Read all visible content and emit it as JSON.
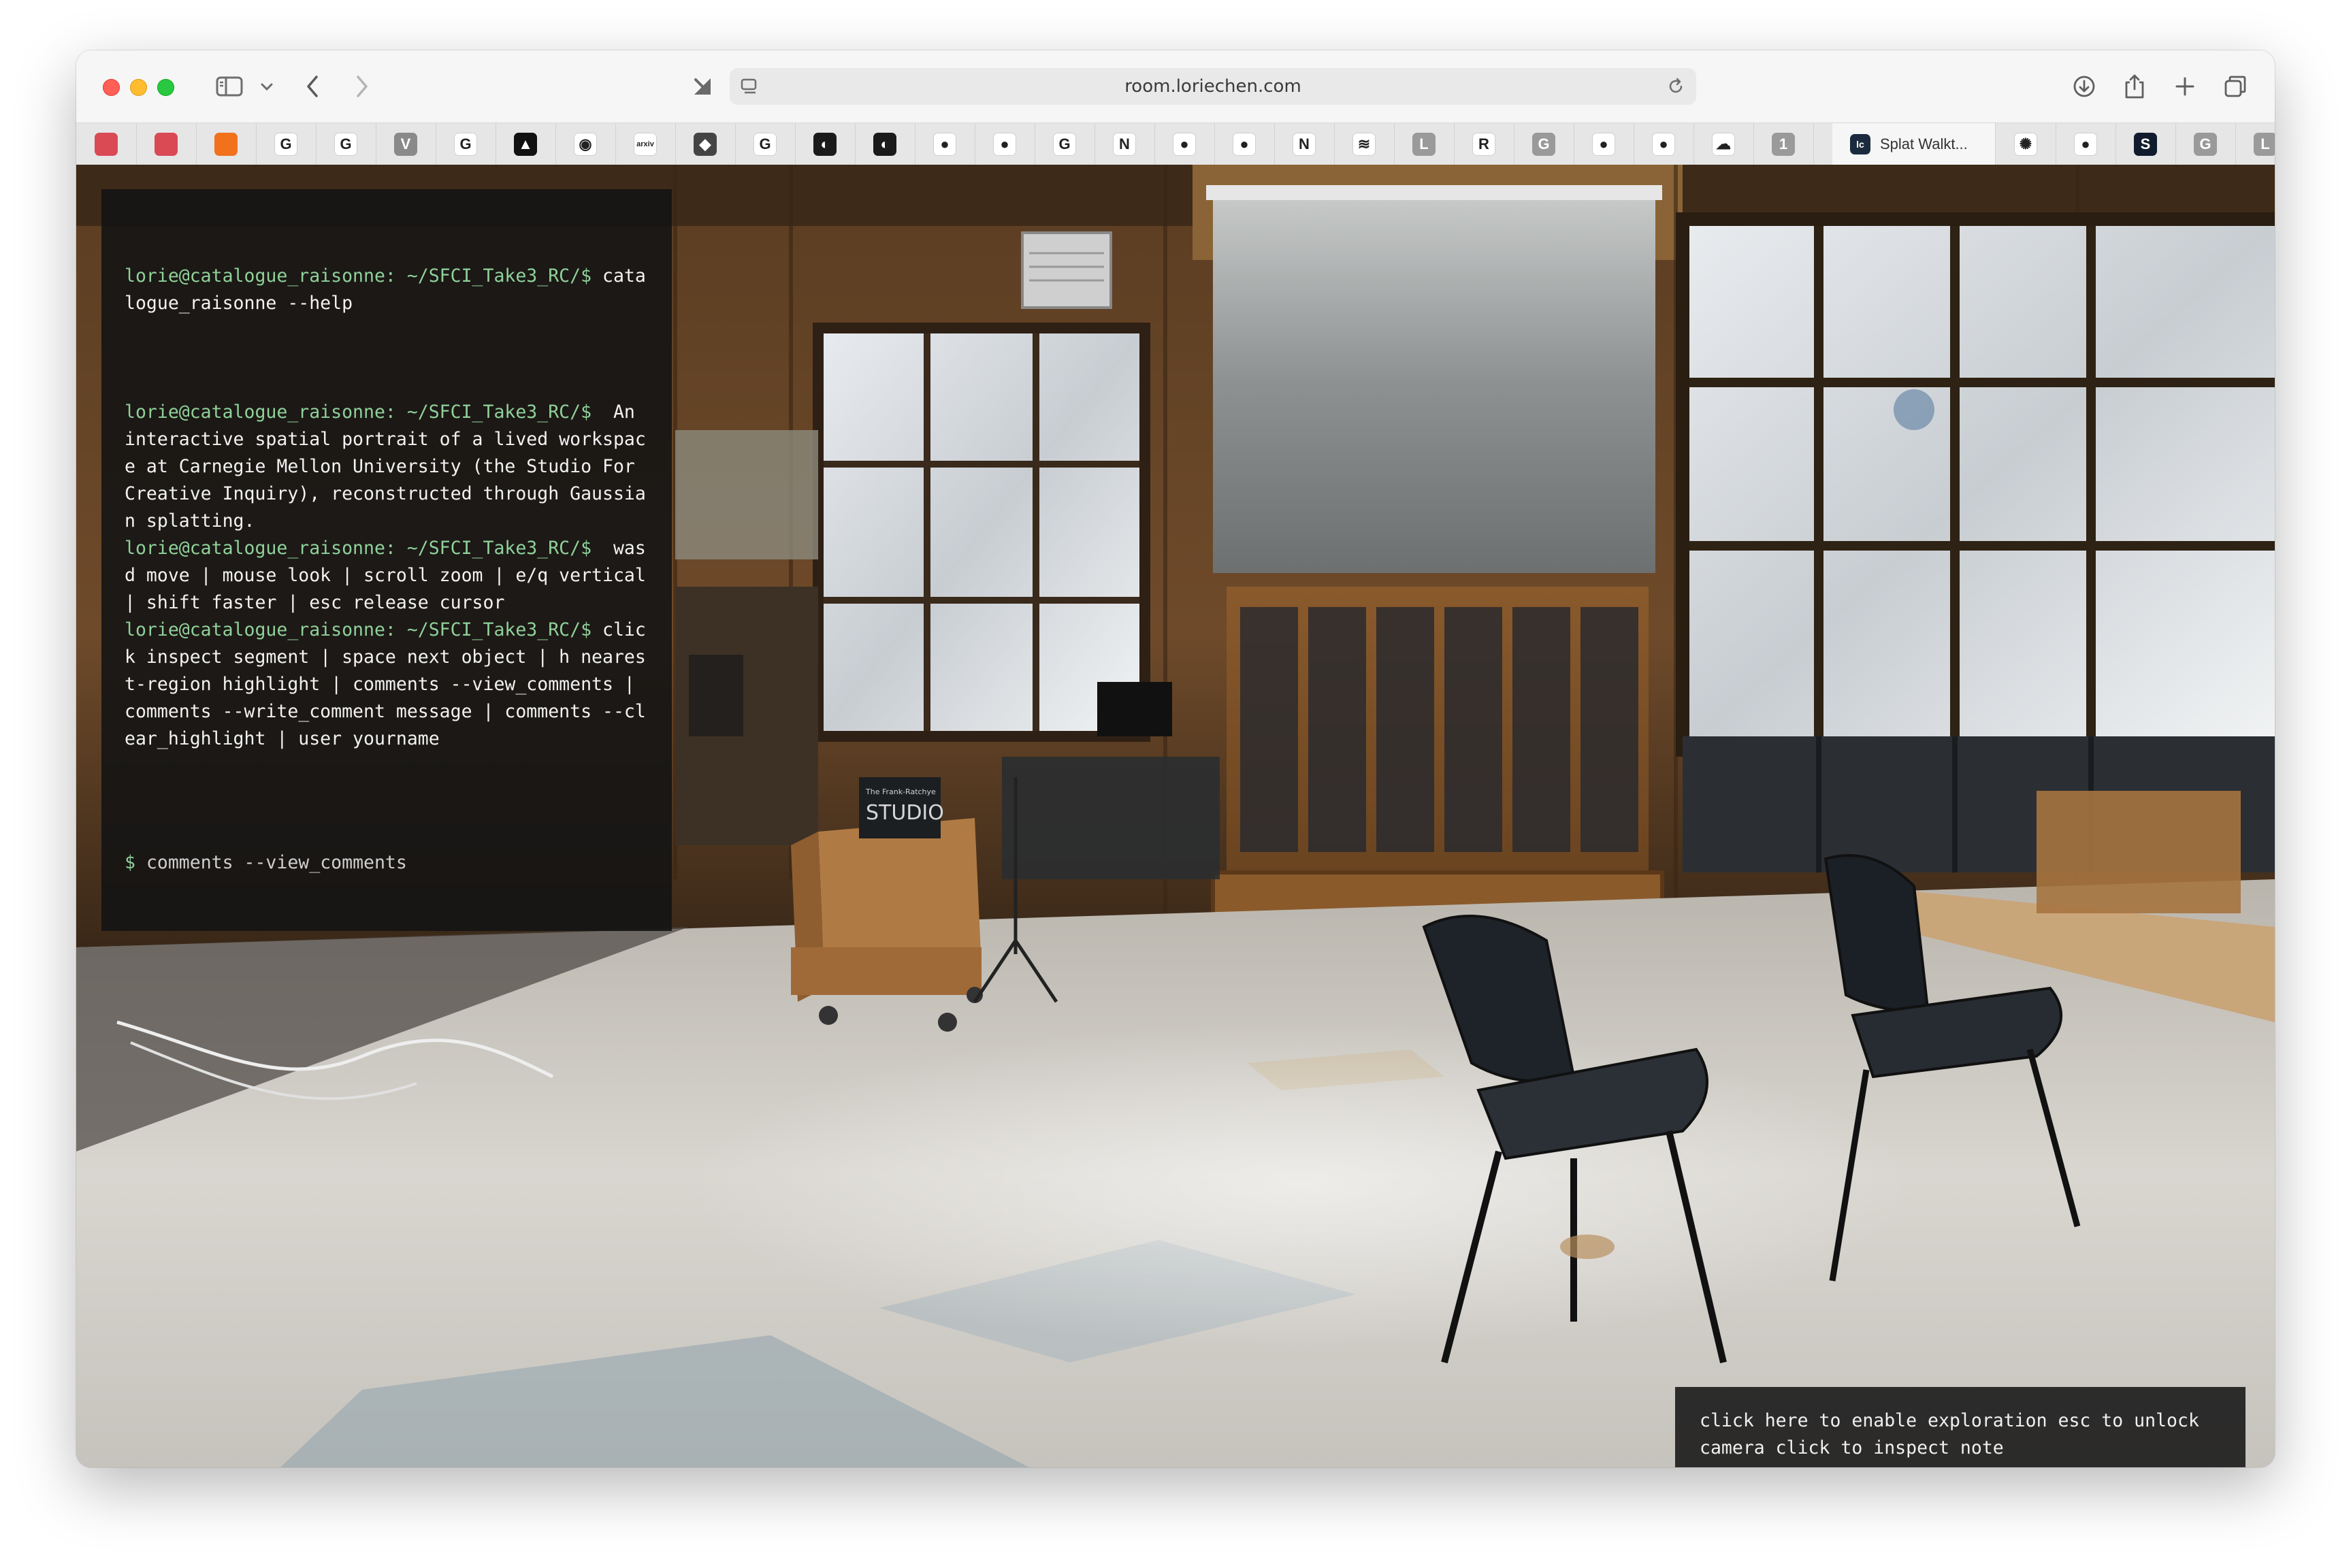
{
  "browser": {
    "url": "room.loriechen.com",
    "active_tab_title": "Splat Walkt...",
    "active_tab_icon_text": "lc",
    "favorites": [
      {
        "icon": "bookmark-red-icon",
        "glyph": "",
        "color": "#d94a55"
      },
      {
        "icon": "bookmark-red-icon",
        "glyph": "",
        "color": "#d94a55"
      },
      {
        "icon": "stack-orange-icon",
        "glyph": "",
        "color": "#f2711c"
      },
      {
        "icon": "google-icon",
        "glyph": "G",
        "color": "#ffffff"
      },
      {
        "icon": "google-icon",
        "glyph": "G",
        "color": "#ffffff"
      },
      {
        "icon": "v-icon",
        "glyph": "V",
        "color": "#8a8a8a"
      },
      {
        "icon": "google-icon",
        "glyph": "G",
        "color": "#ffffff"
      },
      {
        "icon": "triangle-black-icon",
        "glyph": "▲",
        "color": "#111111"
      },
      {
        "icon": "openai-icon",
        "glyph": "◉",
        "color": "#ffffff"
      },
      {
        "icon": "arxiv-icon",
        "glyph": "arxiv",
        "color": "#ffffff"
      },
      {
        "icon": "cube-icon",
        "glyph": "◆",
        "color": "#444444"
      },
      {
        "icon": "google-icon",
        "glyph": "G",
        "color": "#ffffff"
      },
      {
        "icon": "moon-app-icon",
        "glyph": "◐",
        "color": "#1a1a1a"
      },
      {
        "icon": "moon-app-icon",
        "glyph": "◐",
        "color": "#1a1a1a"
      },
      {
        "icon": "github-icon",
        "glyph": "●",
        "color": "#ffffff"
      },
      {
        "icon": "github-icon",
        "glyph": "●",
        "color": "#ffffff"
      },
      {
        "icon": "google-icon",
        "glyph": "G",
        "color": "#ffffff"
      },
      {
        "icon": "notion-icon",
        "glyph": "N",
        "color": "#ffffff"
      },
      {
        "icon": "github-icon",
        "glyph": "●",
        "color": "#ffffff"
      },
      {
        "icon": "github-icon",
        "glyph": "●",
        "color": "#ffffff"
      },
      {
        "icon": "notion-icon",
        "glyph": "N",
        "color": "#ffffff"
      },
      {
        "icon": "linear-icon",
        "glyph": "≋",
        "color": "#ffffff"
      },
      {
        "icon": "l-letter-icon",
        "glyph": "L",
        "color": "#9a9a9a"
      },
      {
        "icon": "r-logo-icon",
        "glyph": "R",
        "color": "#ffffff"
      },
      {
        "icon": "g-letter-icon",
        "glyph": "G",
        "color": "#9a9a9a"
      },
      {
        "icon": "github-icon",
        "glyph": "●",
        "color": "#ffffff"
      },
      {
        "icon": "github-icon",
        "glyph": "●",
        "color": "#ffffff"
      },
      {
        "icon": "cloudflare-icon",
        "glyph": "☁",
        "color": "#ffffff"
      },
      {
        "icon": "one-letter-icon",
        "glyph": "1",
        "color": "#9a9a9a"
      }
    ],
    "favorites_after": [
      {
        "icon": "pinwheel-red-icon",
        "glyph": "✺",
        "color": "#ffffff"
      },
      {
        "icon": "github-icon",
        "glyph": "●",
        "color": "#ffffff"
      },
      {
        "icon": "s-dark-icon",
        "glyph": "S",
        "color": "#111b2e"
      },
      {
        "icon": "g-letter-icon",
        "glyph": "G",
        "color": "#9a9a9a"
      },
      {
        "icon": "l-letter-icon",
        "glyph": "L",
        "color": "#9a9a9a"
      }
    ]
  },
  "terminal": {
    "entries": [
      {
        "prompt": "lorie@catalogue_raisonne: ~/SFCI_Take3_RC/$",
        "text": "catalogue_raisonne --help"
      },
      {
        "prompt": "lorie@catalogue_raisonne: ~/SFCI_Take3_RC/$",
        "text": "An interactive spatial portrait of a lived workspace at Carnegie Mellon University (the Studio For Creative Inquiry), reconstructed through Gaussian splatting."
      },
      {
        "prompt": "lorie@catalogue_raisonne: ~/SFCI_Take3_RC/$",
        "text": "wasd move | mouse look | scroll zoom | e/q vertical | shift faster | esc release cursor"
      },
      {
        "prompt": "lorie@catalogue_raisonne: ~/SFCI_Take3_RC/$",
        "text": "click inspect segment | space next object | h nearest-region highlight | comments --view_comments | comments --write_comment message | comments --clear_highlight | user yourname"
      }
    ],
    "input_prompt": "$",
    "input_command": "comments --view_comments"
  },
  "hint": {
    "text": "click here to enable exploration esc to unlock camera click to inspect note"
  },
  "scene": {
    "sign_line1": "The Frank-Ratchye",
    "sign_line2": "STUDIO"
  }
}
